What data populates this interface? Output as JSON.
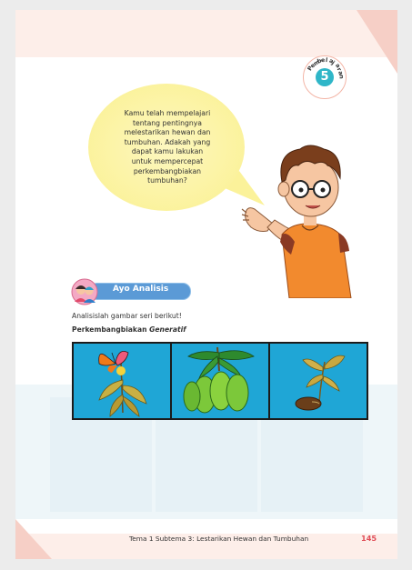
{
  "badge": {
    "word": "Pembelajaran",
    "number": "5"
  },
  "speech": {
    "lines": [
      "Kamu telah mempelajari",
      "tentang pentingnya",
      "melestarikan hewan dan",
      "tumbuhan. Adakah yang",
      "dapat kamu lakukan",
      "untuk mempercepat",
      "perkembangbiakan",
      "tumbuhan?"
    ]
  },
  "activity": {
    "label": "Ayo Analisis"
  },
  "instruction": "Analisislah gambar seri berikut!",
  "subheading": {
    "prefix": "Perkembangbiakan ",
    "italic": "Generatif"
  },
  "panels": [
    "butterfly-on-flower",
    "mango-fruits",
    "sprouting-seed"
  ],
  "footer": {
    "text": "Tema 1 Subtema 3: Lestarikan Hewan dan Tumbuhan",
    "page": "145"
  },
  "colors": {
    "accent_blue": "#5b9ad6",
    "panel_blue": "#1fa6d6",
    "bubble_yellow": "#fbf29a",
    "page_number_red": "#e04d57"
  }
}
